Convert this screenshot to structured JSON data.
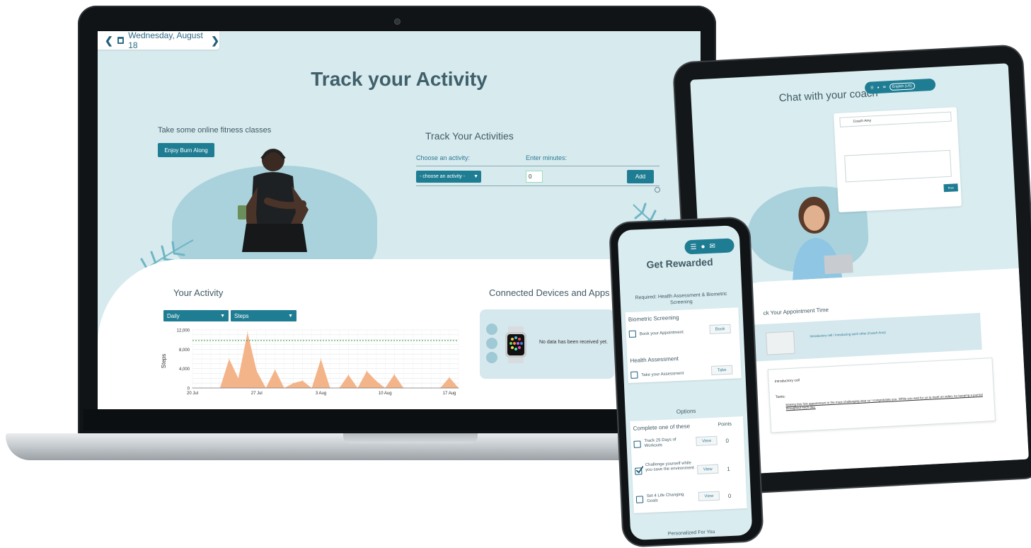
{
  "laptop": {
    "date_nav": {
      "prev": "❮",
      "date": "Wednesday, August 18",
      "next": "❯"
    },
    "title": "Track your Activity",
    "classes_text": "Take some online fitness classes",
    "burn_button": "Enjoy Burn Along",
    "track_heading": "Track Your Activities",
    "choose_label": "Choose an activity:",
    "minutes_label": "Enter minutes:",
    "activity_select": "- choose an activity -",
    "minutes_value": "0",
    "add_button": "Add",
    "your_activity": "Your Activity",
    "period_select": "Daily",
    "metric_select": "Steps",
    "connected_title": "Connected Devices and Apps",
    "no_data": "No data has been received yet."
  },
  "chart_data": {
    "type": "area",
    "ylabel": "Steps",
    "ylim": [
      0,
      12000
    ],
    "yticks": [
      "12,000",
      "8,000",
      "4,000",
      "0"
    ],
    "xticks": [
      "20 Jul",
      "27 Jul",
      "3 Aug",
      "10 Aug",
      "17 Aug"
    ],
    "goal": 9800,
    "x": [
      "20 Jul",
      "21 Jul",
      "22 Jul",
      "23 Jul",
      "24 Jul",
      "25 Jul",
      "26 Jul",
      "27 Jul",
      "28 Jul",
      "29 Jul",
      "30 Jul",
      "31 Jul",
      "1 Aug",
      "2 Aug",
      "3 Aug",
      "4 Aug",
      "5 Aug",
      "6 Aug",
      "7 Aug",
      "8 Aug",
      "9 Aug",
      "10 Aug",
      "11 Aug",
      "12 Aug",
      "13 Aug",
      "14 Aug",
      "15 Aug",
      "16 Aug",
      "17 Aug",
      "18 Aug"
    ],
    "values": [
      0,
      0,
      0,
      0,
      6000,
      2000,
      11500,
      3500,
      0,
      3800,
      0,
      1000,
      1500,
      0,
      6000,
      0,
      0,
      2700,
      0,
      3500,
      1500,
      0,
      2800,
      0,
      0,
      0,
      0,
      0,
      2200,
      0
    ]
  },
  "tablet": {
    "title": "Chat with your coach",
    "language": "English (US)",
    "coach_name": "Coach Amy",
    "post_button": "Post",
    "appointment_heading": "ck Your Appointment Time",
    "appointment_link": "Introductory call / Introducing each other (Coach Amy)",
    "intro_title": "Introductory call",
    "tasks_label": "Tasks:",
    "task_text": "Making this first appointment is the most challenging step so I congratulate you. While you wait for us to meet on video, try keeping a journal throughout each day."
  },
  "phone": {
    "title": "Get Rewarded",
    "required": "Required: Health Assessment & Biometric Screening",
    "biometric_title": "Biometric Screening",
    "book_text": "Book your Appointment",
    "book_button": "Book",
    "health_title": "Health Assessment",
    "take_text": "Take your Assessment",
    "take_button": "Take",
    "options": "Options",
    "complete_one": "Complete one of these",
    "points_header": "Points",
    "tasks": [
      {
        "label": "Track 25 Days of Workouts",
        "button": "View",
        "points": "0",
        "checked": false
      },
      {
        "label": "Challenge yourself while you save the environment",
        "button": "View",
        "points": "1",
        "checked": true
      },
      {
        "label": "Set 4 Life Changing Goals",
        "button": "View",
        "points": "0",
        "checked": false
      }
    ],
    "personalized": "Personalized For You"
  },
  "colors": {
    "accent": "#1f7d93",
    "background": "#d7eaee",
    "chart_fill": "#f4b48a",
    "goal_line": "#2e9a3e"
  }
}
